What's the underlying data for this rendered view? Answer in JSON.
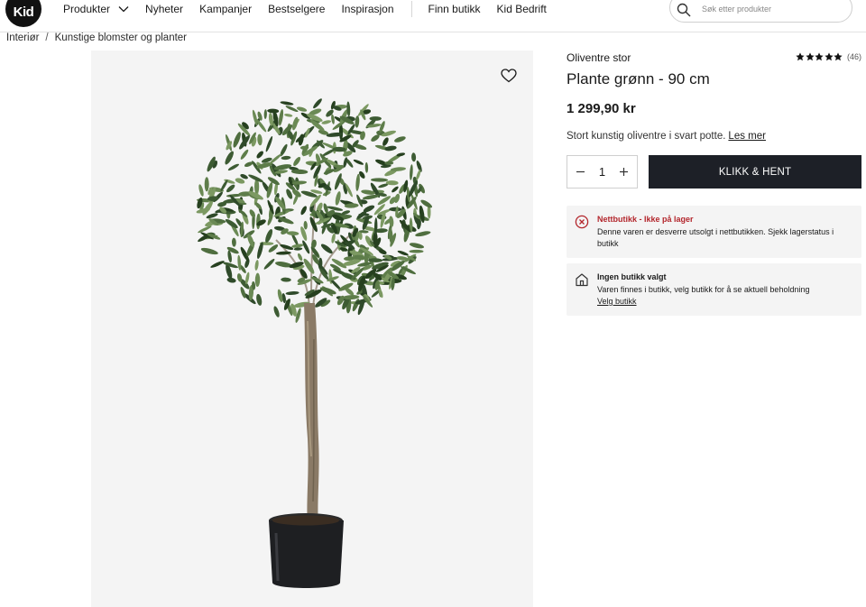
{
  "header": {
    "logo_text": "Kid",
    "nav": {
      "produkter": "Produkter",
      "nyheter": "Nyheter",
      "kampanjer": "Kampanjer",
      "bestselgere": "Bestselgere",
      "inspirasjon": "Inspirasjon",
      "finn_butikk": "Finn butikk",
      "kid_bedrift": "Kid Bedrift"
    },
    "search": {
      "placeholder": "Søk etter produkter",
      "value": ""
    }
  },
  "breadcrumb": {
    "items": [
      "Interiør",
      "Kunstige blomster og planter"
    ],
    "separator": "/"
  },
  "product": {
    "subtitle": "Oliventre stor",
    "title": "Plante grønn - 90 cm",
    "price": "1 299,90 kr",
    "description": "Stort kunstig oliventre i svart potte.",
    "read_more": "Les mer",
    "rating": {
      "stars": 5,
      "max": 5,
      "count_label": "(46)"
    },
    "quantity": "1",
    "cta_label": "KLIKK & HENT"
  },
  "notices": {
    "online": {
      "heading": "Nettbutikk - Ikke på lager",
      "body": "Denne varen er desverre utsolgt i nettbutikken. Sjekk lagerstatus i butikk"
    },
    "store": {
      "heading": "Ingen butikk valgt",
      "body": "Varen finnes i butikk, velg butikk for å se aktuell beholdning",
      "link": "Velg butikk"
    }
  },
  "colors": {
    "cta_bg": "#1d2027",
    "alert_red": "#b3262c",
    "panel_bg": "#f4f4f4"
  },
  "icons": [
    "search-icon",
    "chevron-down-icon",
    "heart-icon",
    "star-icon",
    "minus-icon",
    "plus-icon",
    "error-circle-icon",
    "store-icon"
  ]
}
